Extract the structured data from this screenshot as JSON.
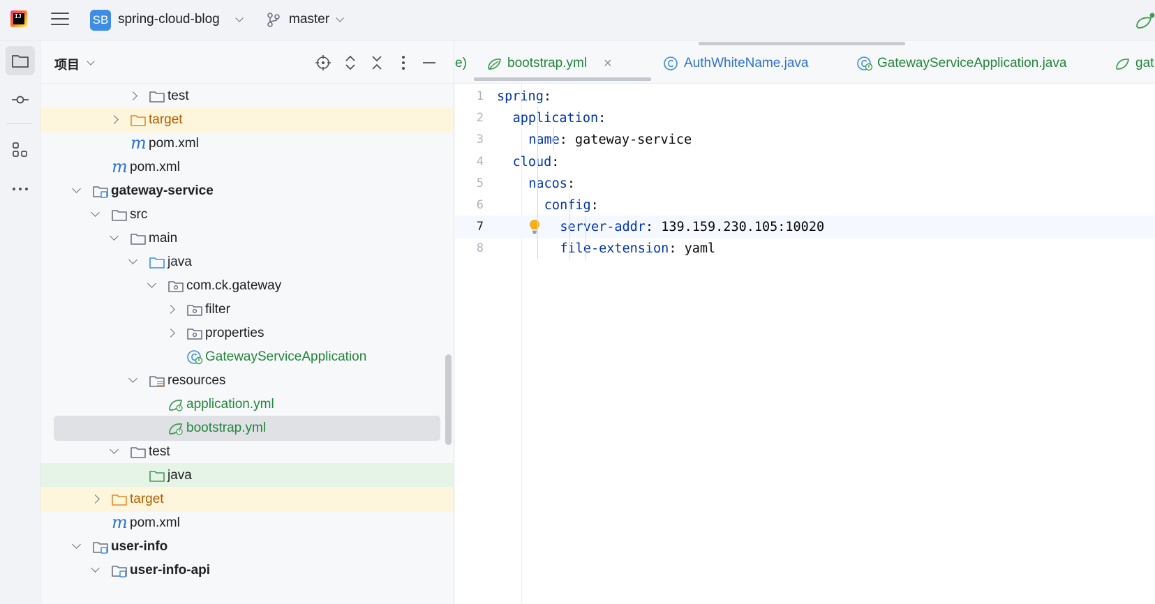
{
  "titlebar": {
    "project_badge": "SB",
    "project_name": "spring-cloud-blog",
    "branch_name": "master"
  },
  "toolstrip": {
    "items": [
      "project-icon",
      "commit-icon",
      "structure-icon",
      "more-icon"
    ]
  },
  "project_panel": {
    "title": "项目",
    "header_icons": [
      "locate-icon",
      "expand-all-icon",
      "collapse-all-icon",
      "options-icon",
      "hide-icon"
    ],
    "tree": [
      {
        "label": "test",
        "type": "folder"
      },
      {
        "label": "target",
        "type": "folder-excluded"
      },
      {
        "label": "pom.xml",
        "type": "maven"
      },
      {
        "label": "pom.xml",
        "type": "maven"
      },
      {
        "label": "gateway-service",
        "type": "module"
      },
      {
        "label": "src",
        "type": "folder"
      },
      {
        "label": "main",
        "type": "folder"
      },
      {
        "label": "java",
        "type": "source-root"
      },
      {
        "label": "com.ck.gateway",
        "type": "package"
      },
      {
        "label": "filter",
        "type": "package"
      },
      {
        "label": "properties",
        "type": "package"
      },
      {
        "label": "GatewayServiceApplication",
        "type": "spring-class"
      },
      {
        "label": "resources",
        "type": "resources-root"
      },
      {
        "label": "application.yml",
        "type": "spring-yml"
      },
      {
        "label": "bootstrap.yml",
        "type": "spring-yml"
      },
      {
        "label": "test",
        "type": "folder"
      },
      {
        "label": "java",
        "type": "test-root"
      },
      {
        "label": "target",
        "type": "folder-excluded"
      },
      {
        "label": "pom.xml",
        "type": "maven"
      },
      {
        "label": "user-info",
        "type": "module"
      },
      {
        "label": "user-info-api",
        "type": "module"
      }
    ]
  },
  "editor": {
    "tabs": [
      {
        "label": "e)",
        "icon": "none"
      },
      {
        "label": "bootstrap.yml",
        "icon": "spring-yml-icon",
        "active": true
      },
      {
        "label": "AuthWhiteName.java",
        "icon": "class-icon"
      },
      {
        "label": "GatewayServiceApplication.java",
        "icon": "spring-class-icon"
      },
      {
        "label": "gat",
        "icon": "spring-yml-icon"
      }
    ],
    "close_glyph": "×",
    "current_line": 7,
    "lines": [
      {
        "num": "1",
        "key": "spring",
        "sep": ":",
        "value": ""
      },
      {
        "num": "2",
        "key": "application",
        "sep": ":",
        "value": ""
      },
      {
        "num": "3",
        "key": "name",
        "sep": ":",
        "value": " gateway-service"
      },
      {
        "num": "4",
        "key": "cloud",
        "sep": ":",
        "value": ""
      },
      {
        "num": "5",
        "key": "nacos",
        "sep": ":",
        "value": ""
      },
      {
        "num": "6",
        "key": "config",
        "sep": ":",
        "value": ""
      },
      {
        "num": "7",
        "key": "server-addr",
        "sep": ":",
        "value": " 139.159.230.105:10020"
      },
      {
        "num": "8",
        "key": "file-extension",
        "sep": ":",
        "value": " yaml"
      }
    ]
  },
  "colors": {
    "yaml_key": "#0033b3",
    "spring_green": "#22863a",
    "excluded_orange": "#b35e00",
    "maven_blue": "#2e72d2",
    "bulb_yellow": "#f2b01e"
  }
}
